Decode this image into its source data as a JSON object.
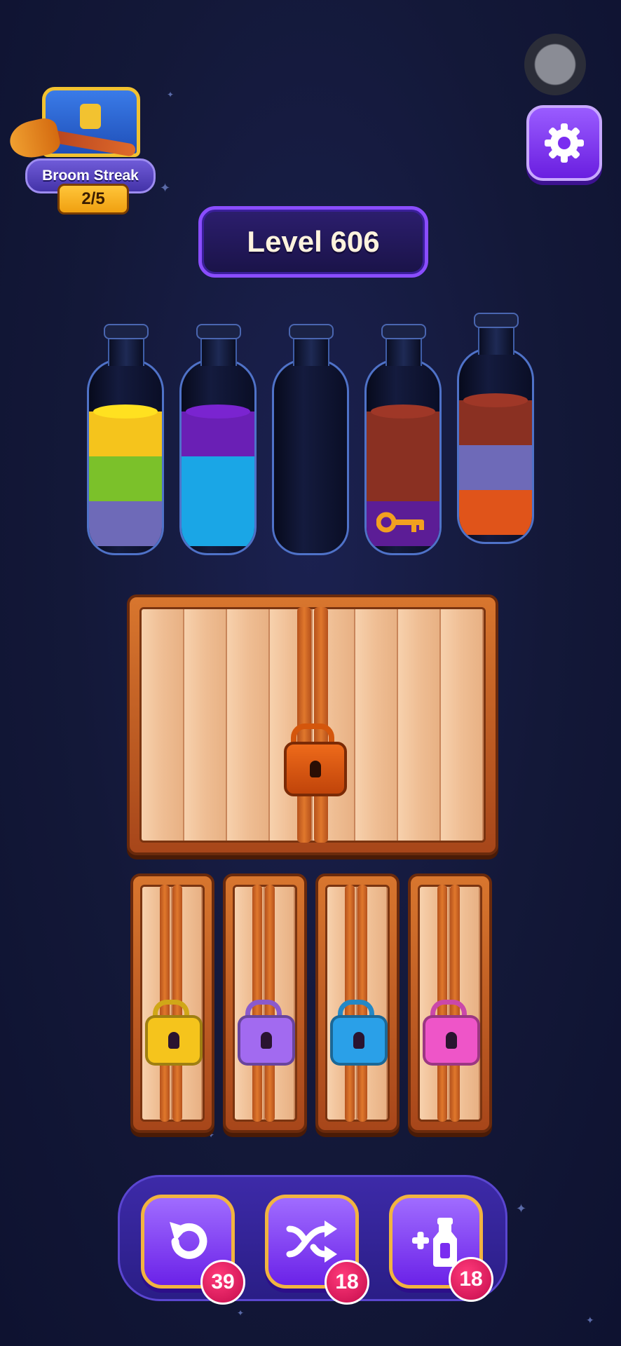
{
  "header": {
    "streak": {
      "label": "Broom Streak",
      "progress": "2/5"
    },
    "level_label": "Level 606"
  },
  "bottles": [
    {
      "layers": [
        "#f5c41c",
        "#7bc12a",
        "#6e6ab8"
      ]
    },
    {
      "layers": [
        "#6a1fb5",
        "#1aa6e6",
        "#1aa6e6"
      ]
    },
    {
      "layers": []
    },
    {
      "layers": [
        "#8a3022",
        "#8a3022",
        "#5c1d96"
      ],
      "hidden_item": "key-icon"
    },
    {
      "layers": [
        "#8a3022",
        "#6e6ab8",
        "#e0541a"
      ]
    }
  ],
  "locks": {
    "large_lock_color": "#ee6a1a",
    "small_locks": [
      {
        "color": "#f5c41c"
      },
      {
        "color": "#a26af0"
      },
      {
        "color": "#2aa0e8"
      },
      {
        "color": "#ee55c8"
      }
    ]
  },
  "boosters": [
    {
      "name": "undo",
      "count": "39"
    },
    {
      "name": "shuffle",
      "count": "18"
    },
    {
      "name": "add-bottle",
      "count": "18"
    }
  ]
}
